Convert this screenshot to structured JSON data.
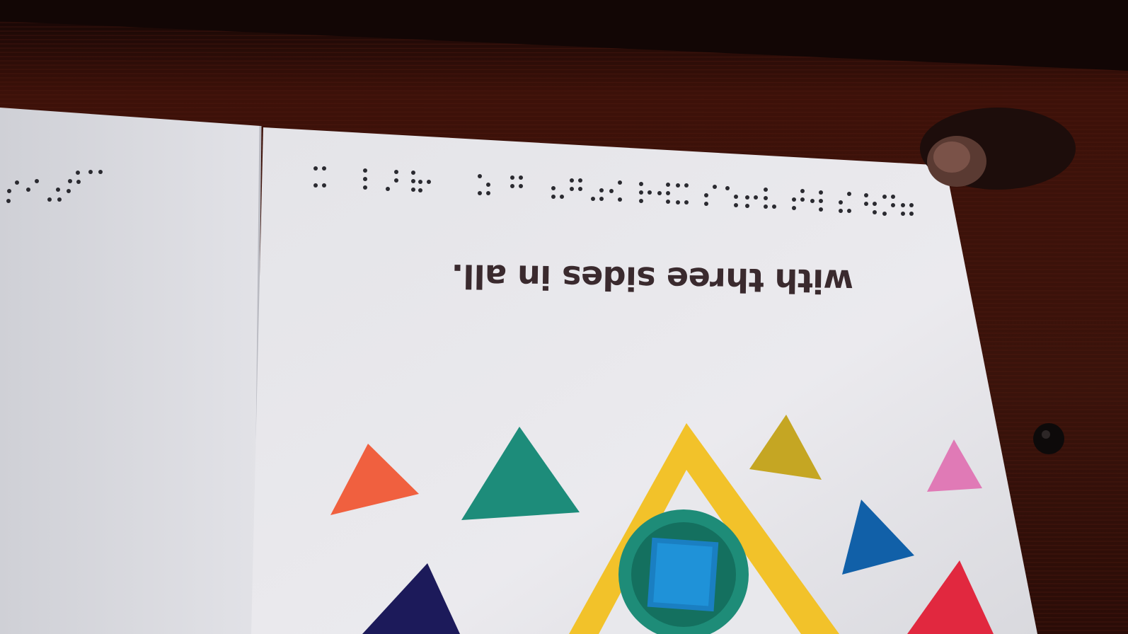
{
  "photo": {
    "description_text": "with three sides in all.",
    "colors": {
      "table_wood": "#3b120b",
      "background_dark": "#140806",
      "page_white": "#e6e6ea",
      "left_page_white": "#dcdde2",
      "braille_dots": "#2a2a30",
      "triangle_orange": "#f0603f",
      "triangle_teal": "#1d8c7a",
      "triangle_mustard": "#c5a623",
      "triangle_pink": "#e07ab6",
      "triangle_blue": "#1160a8",
      "triangle_red": "#e1283f",
      "triangle_navy": "#1c1a5a",
      "frame_yellow": "#f2c22a",
      "inner_circle_teal": "#1e8c78",
      "inner_square_blue": "#1a7fc2"
    },
    "icons": [
      "table-surface",
      "open-board-book",
      "braille-line",
      "tactile-triangle-frame",
      "colored-triangles",
      "thumb"
    ]
  }
}
